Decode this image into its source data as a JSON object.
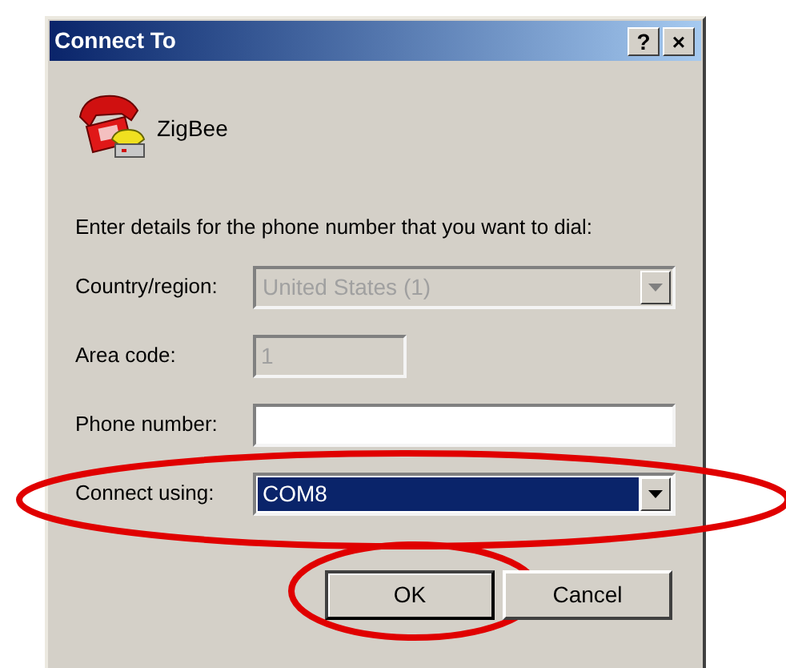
{
  "window": {
    "title": "Connect To",
    "title_buttons": [
      "?",
      "×"
    ]
  },
  "connection": {
    "name": "ZigBee"
  },
  "prompt": "Enter details for the phone number that you want to dial:",
  "fields": [
    {
      "label": "Country/region:",
      "kind": "dropdown",
      "value": "United States (1)",
      "disabled": true,
      "selected": false
    },
    {
      "label": "Area code:",
      "kind": "text",
      "value": "1",
      "disabled": true
    },
    {
      "label": "Phone number:",
      "kind": "text",
      "disabled": false
    },
    {
      "label": "Connect using:",
      "kind": "dropdown",
      "value": "COM8",
      "disabled": false,
      "selected": true,
      "highlighted": true
    }
  ],
  "buttons": [
    {
      "label": "OK",
      "default": true,
      "highlighted": true
    },
    {
      "label": "Cancel",
      "default": false
    }
  ]
}
